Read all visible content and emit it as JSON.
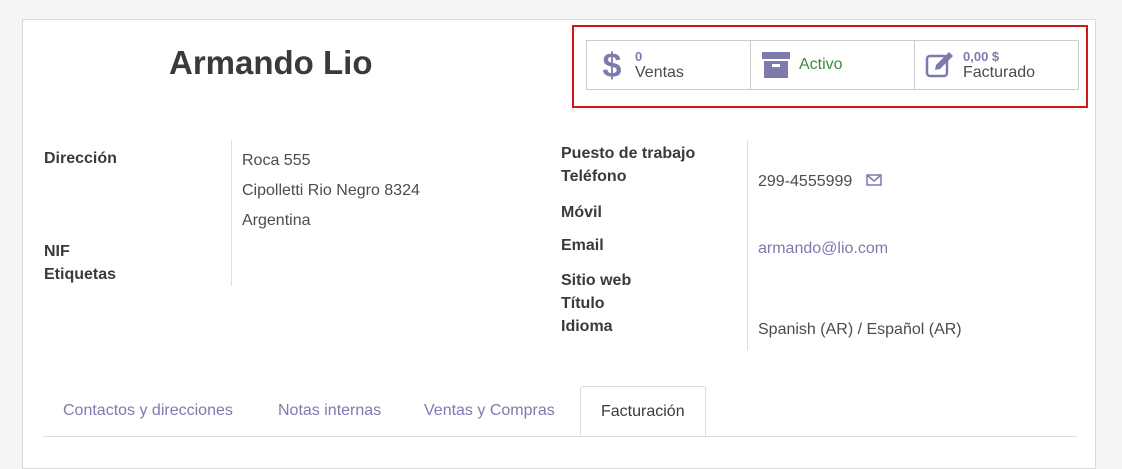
{
  "partner": {
    "name": "Armando Lio"
  },
  "smart_buttons": [
    {
      "value": "0",
      "label": "Ventas",
      "icon": "dollar-icon"
    },
    {
      "value": "",
      "label": "Activo",
      "icon": "archive-icon"
    },
    {
      "value": "0,00 $",
      "label": "Facturado",
      "icon": "edit-icon"
    }
  ],
  "left_fields": {
    "direccion_label": "Dirección",
    "address_line1": "Roca 555",
    "address_line2": "Cipolletti  Rio Negro  8324",
    "address_line3": "Argentina",
    "nif_label": "NIF",
    "etiquetas_label": "Etiquetas"
  },
  "right_fields": {
    "puesto_label": "Puesto de trabajo",
    "telefono_label": "Teléfono",
    "telefono_value": "299-4555999",
    "movil_label": "Móvil",
    "email_label": "Email",
    "email_value": "armando@lio.com",
    "sitio_label": "Sitio web",
    "titulo_label": "Título",
    "idioma_label": "Idioma",
    "idioma_value": "Spanish (AR) / Español (AR)"
  },
  "tabs": [
    {
      "label": "Contactos y direcciones",
      "active": false
    },
    {
      "label": "Notas internas",
      "active": false
    },
    {
      "label": "Ventas y Compras",
      "active": false
    },
    {
      "label": "Facturación",
      "active": true
    }
  ],
  "colors": {
    "accent": "#7c7bad",
    "highlight": "#d2171b",
    "active_green": "#3d8a3d"
  }
}
